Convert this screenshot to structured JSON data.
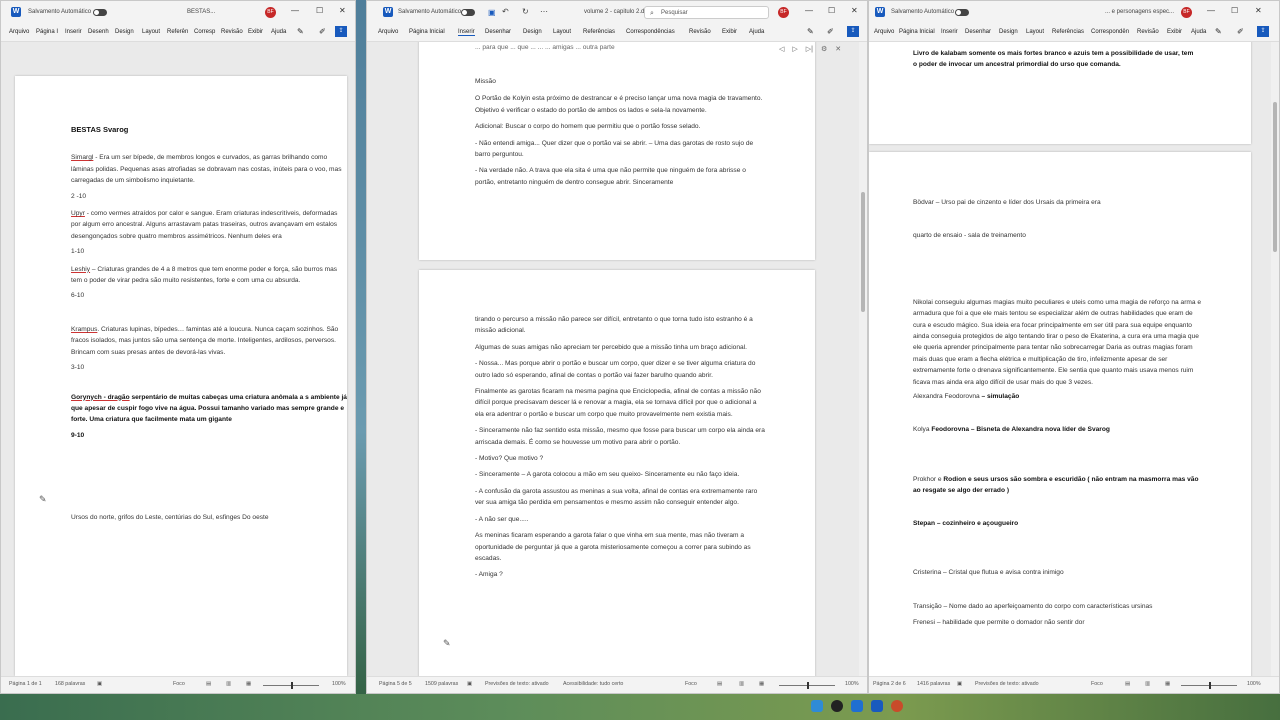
{
  "windows": {
    "left": {
      "autosave_label": "Salvamento Automático",
      "doc_title": "BESTAS...",
      "avatar": "BF",
      "tabs": [
        "Arquivo",
        "Página I",
        "Inserir",
        "Desenh",
        "Design",
        "Layout",
        "Referên",
        "Corresp",
        "Revisão",
        "Exibir",
        "Ajuda"
      ],
      "heading": "BESTAS Svarog",
      "paragraphs": [
        {
          "name": "Simargl",
          "text": " - Era um ser bípede, de membros longos e curvados, as garras brilhando como lâminas polidas. Pequenas asas atrofiadas se dobravam nas costas, inúteis para o voo, mas carregadas de um simbolismo inquietante."
        },
        {
          "range": "2 -10"
        },
        {
          "name": "Upyr",
          "text": " - como vermes atraídos por calor e sangue. Eram criaturas indescritíveis, deformadas por algum erro ancestral. Alguns arrastavam patas traseiras, outros avançavam em estalos desengonçados sobre quatro membros assimétricos. Nenhum deles era"
        },
        {
          "range": "1-10"
        },
        {
          "name": "Leshiy",
          "text": " – Criaturas grandes de 4 a 8 metros que tem enorme poder e força, são burros mas tem o poder de virar pedra são muito resistentes, forte e com uma cu absurda."
        },
        {
          "range": "6-10"
        },
        {
          "name": "Krampus",
          "text": ". Criaturas lupinas, bípedes… famintas até a loucura. Nunca caçam sozinhos. São fracos isolados, mas juntos são uma sentença de morte. Inteligentes, ardilosos, perversos. Brincam com suas presas antes de devorá-las vivas."
        },
        {
          "range": "3-10"
        },
        {
          "name": "Gorynych - dragão",
          "text": " serpentário de muitas cabeças uma criatura anômala a s ambiente já que apesar de cuspir fogo vive na água. Possui tamanho variado mas sempre grande e forte. Uma criatura que facilmente mata um gigante"
        },
        {
          "range": "9-10"
        }
      ],
      "footer_line": "Ursos do norte, grifos do Leste, centúrias do Sul, esfinges Do oeste",
      "status": {
        "page": "Página 1 de 1",
        "words": "168 palavras",
        "focus": "Foco",
        "zoom": "100%"
      }
    },
    "middle": {
      "autosave_label": "Salvamento Automático",
      "doc_title": "volume 2 - capitulo 2.d...",
      "search_placeholder": "Pesquisar",
      "avatar": "BF",
      "tabs": [
        "Arquivo",
        "Página Inicial",
        "Inserir",
        "Desenhar",
        "Design",
        "Layout",
        "Referências",
        "Correspondências",
        "Revisão",
        "Exibir",
        "Ajuda"
      ],
      "top_fragment": "... para que ... que ... ... ... amigas ... outra parte",
      "page1": [
        "Missão",
        "O Portão de Kolyin esta próximo de destrancar e é preciso lançar uma nova magia de travamento. Objetivo é verificar o estado do portão de ambos os lados e sela-la novamente.",
        "Adicional:  Buscar o corpo do homem que permitiu que o portão fosse selado.",
        "- Não entendi amiga... Quer dizer que o portão vai se abrir. – Uma das garotas de rosto sujo de barro perguntou.",
        "- Na verdade não. A trava que ela sita é uma que não permite que ninguém de fora abrisse o portão, entretanto ninguém de dentro consegue abrir. Sinceramente"
      ],
      "page2": [
        "tirando o percurso a missão não parece ser difícil, entretanto o que torna tudo isto estranho é a missão adicional.",
        "Algumas de suas amigas não apreciam ter percebido que a missão tinha um braço adicional.",
        "- Nossa... Mas porque abrir o portão e buscar um corpo, quer dizer e se tiver alguma criatura do outro lado só esperando, afinal de contas o portão vai fazer barulho quando abrir.",
        "Finalmente as garotas ficaram na mesma pagina que Enciclopedia, afinal de contas a missão não difícil porque precisavam descer lá e renovar a magia, ela se tornava difícil por que o adicional a ela era adentrar o portão e buscar um corpo que muito provavelmente nem existia mais.",
        "- Sinceramente não faz sentido esta missão, mesmo que fosse para buscar um corpo ela ainda era arriscada demais. É como se houvesse um motivo para abrir o portão.",
        "- Motivo? Que motivo ?",
        "- Sinceramente – A garota colocou a mão em seu queixo- Sinceramente eu não faço ideia.",
        "- A confusão da garota assustou as meninas a sua volta, afinal de contas era extremamente raro ver sua amiga tão perdida em pensamentos e mesmo assim não conseguir entender algo.",
        "- A não ser que.....",
        "As meninas ficaram esperando a garota falar o que vinha em sua mente, mas não tiveram a oportunidade de perguntar já que a garota misteriosamente começou a correr para subindo as escadas.",
        "- Amiga ?"
      ],
      "status": {
        "page": "Página 5 de 5",
        "words": "1509 palavras",
        "predict": "Previsões de texto: ativado",
        "access": "Acessibilidade: tudo certo",
        "focus": "Foco",
        "zoom": "100%"
      }
    },
    "right": {
      "autosave_label": "Salvamento Automático",
      "doc_title": "... e personagens espec...",
      "avatar": "BF",
      "tabs": [
        "Arquivo",
        "Página Inicial",
        "Inserir",
        "Desenhar",
        "Design",
        "Layout",
        "Referências",
        "Correspondên",
        "Revisão",
        "Exibir",
        "Ajuda"
      ],
      "top_text": "Livro de kalabam somente os mais fortes branco e azuis tem a possibilidade de usar, tem o poder de invocar um ancestral primordial do urso que comanda.",
      "lines": [
        {
          "plain": "Bödvar – Urso pai de cinzento e líder dos Ursais da primeira era"
        },
        {
          "plain": "quarto de ensaio  - sala de treinamento"
        },
        {
          "plain": "Nikolai conseguiu algumas magias muito peculiares e uteis como uma magia de reforço na arma e armadura que foi a que ele mais tentou se especializar além de outras habilidades que eram de cura e escudo mágico. Sua ideia era focar principalmente em ser útil para sua equipe enquanto ainda conseguia protegidos de algo tentando tirar o peso de Ekaterina, a cura era uma magia que ele queria aprender principalmente para tentar não sobrecarregar Daria as outras magias foram mais duas que eram a flecha elétrica e multiplicação de tiro, infelizmente apesar de ser extremamente forte o drenava significantemente. Ele sentia que quanto mais usava menos ruim ficava mas ainda era algo difícil de usar mais do que 3 vezes."
        },
        {
          "plain": "Alexandra Feodorovna ",
          "bold": "– simulação"
        },
        {
          "plain": "Kolya ",
          "bold": "Feodorovna – Bisneta de Alexandra nova líder de Svarog"
        },
        {
          "plain": "Prokhor e ",
          "bold": "Rodion e seus ursos são sombra e escuridão ( não entram na masmorra mas vão ao resgate se algo der errado )"
        },
        {
          "plain": "",
          "bold": "Stepan – cozinheiro e açougueiro"
        },
        {
          "plain": "Cristerina – Cristal que flutua e avisa contra inimigo"
        },
        {
          "plain": "Transição – Nome dado ao aperfeiçoamento do corpo com características ursinas"
        },
        {
          "plain": "Frenesi – habilidade que permite o domador não sentir dor"
        }
      ],
      "status": {
        "page": "Página 2 de 6",
        "words": "1416 palavras",
        "predict": "Previsões de texto: ativado",
        "focus": "Foco",
        "zoom": "100%"
      }
    }
  }
}
